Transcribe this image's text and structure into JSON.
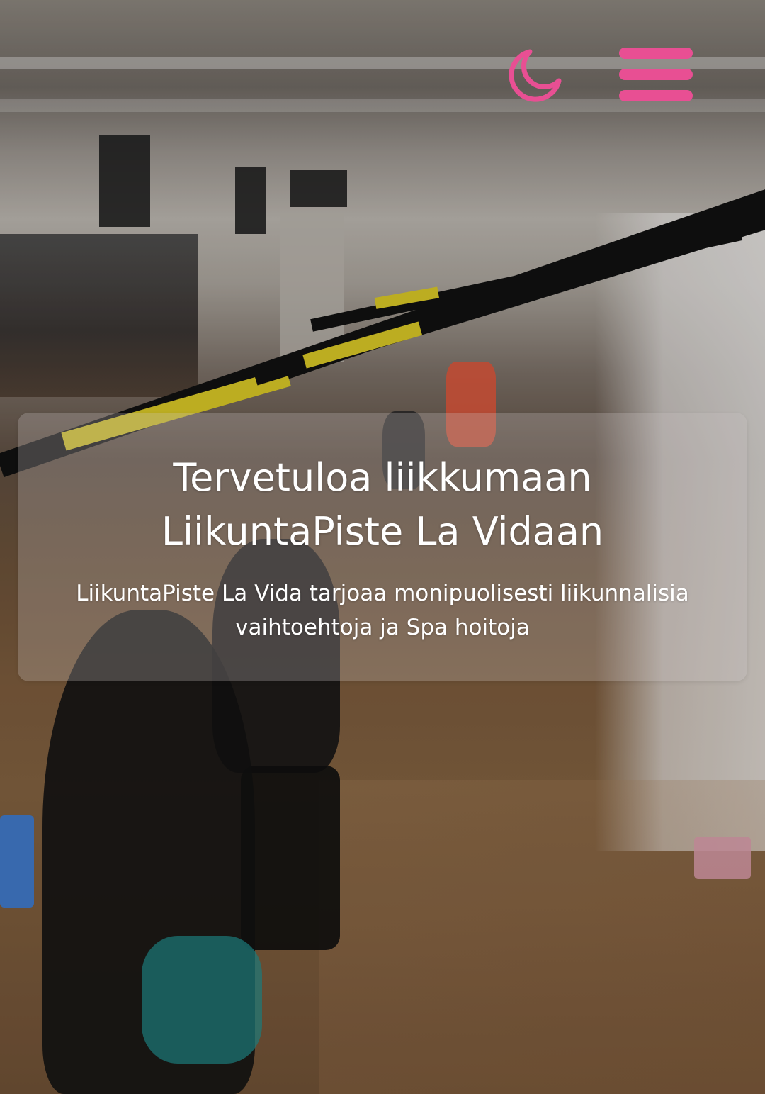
{
  "header": {
    "dark_mode_icon": "moon-icon",
    "menu_icon": "hamburger-menu-icon",
    "accent_color": "#e84f93"
  },
  "hero": {
    "title_line_1": "Tervetuloa liikkumaan",
    "title_line_2": "LiikuntaPiste La Vidaan",
    "subtitle": "LiikuntaPiste La Vida tarjoaa monipuolisesti liikunnalisia vaihtoehtoja ja Spa hoitoja"
  }
}
